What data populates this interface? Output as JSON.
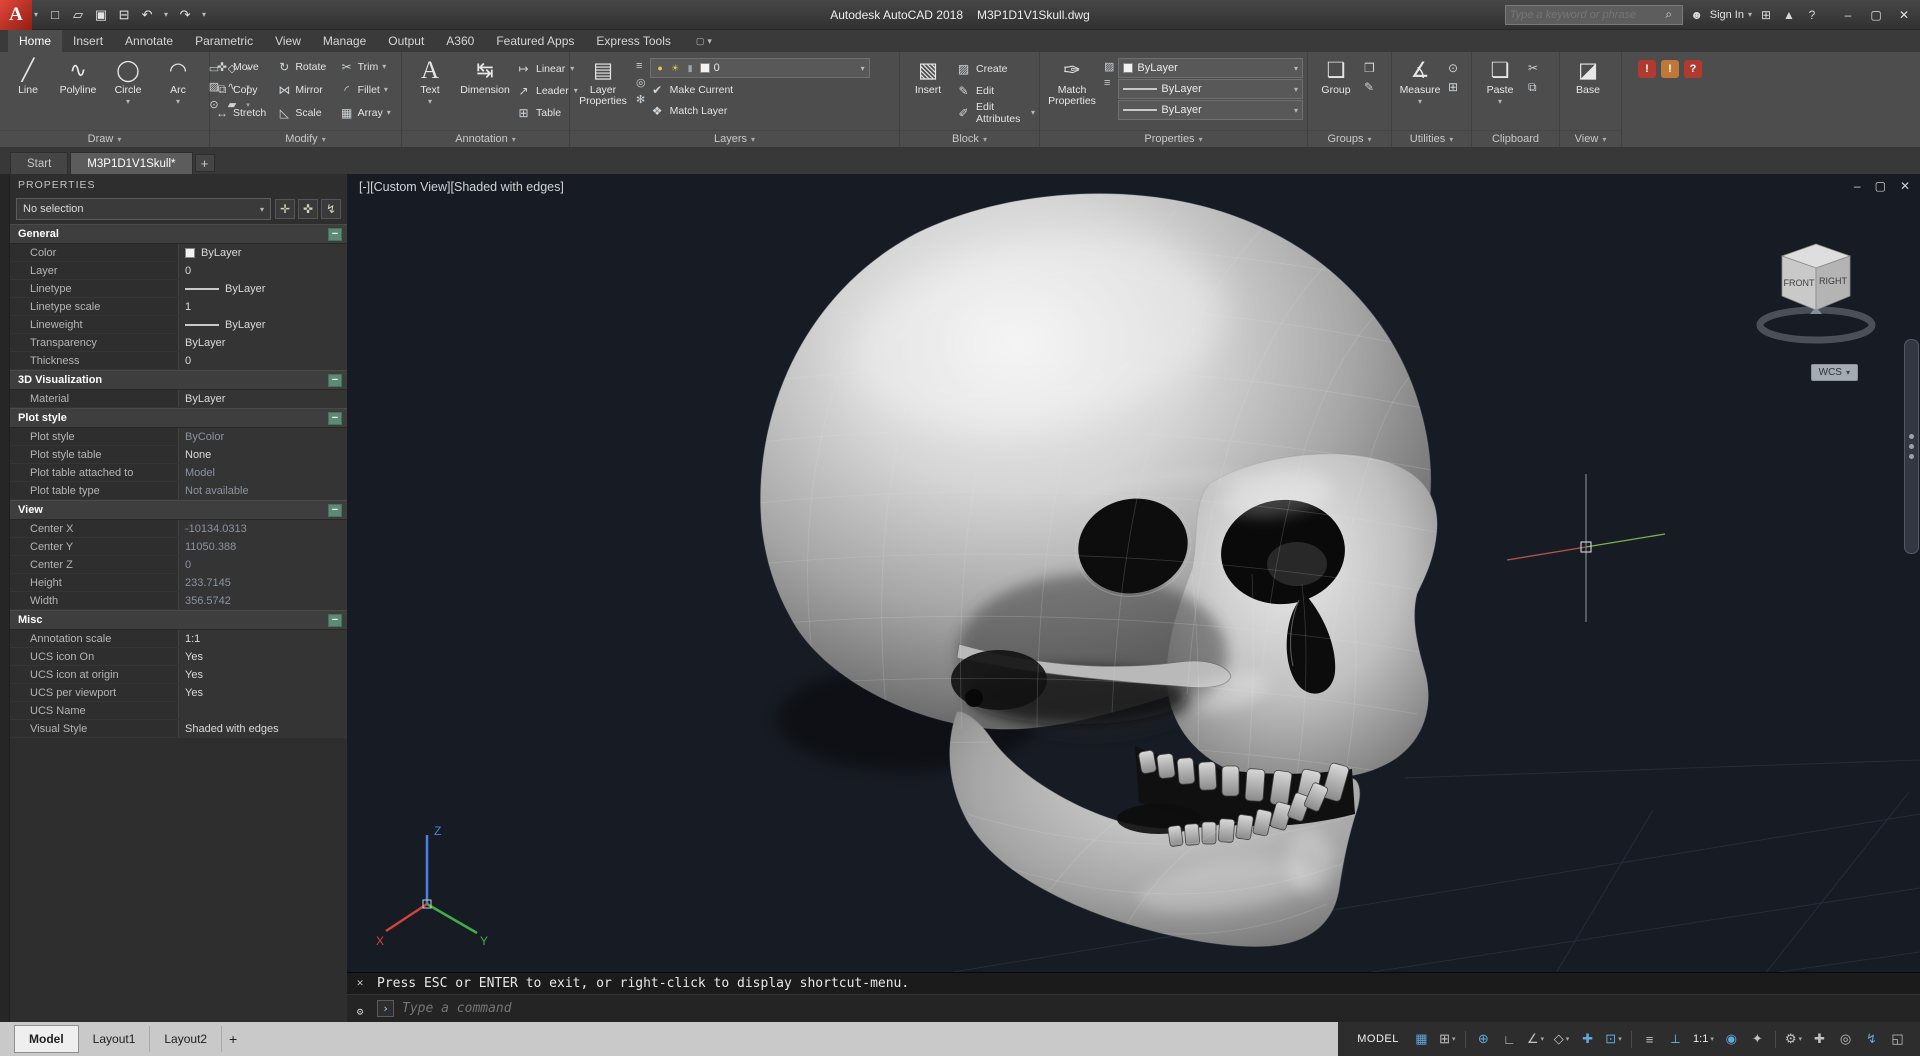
{
  "colors": {
    "logo_red": "#c8372b",
    "titlebar_bg": "#3c3c3c",
    "ribbon_bg": "#4d4d4d",
    "palette_bg": "#2e2e2e",
    "viewport_bg": "#171b23",
    "accent_blue": "#5fa8dc",
    "axis_x_red": "#d0453a",
    "axis_y_green": "#3fae4a",
    "axis_z_blue": "#4a7fe8",
    "collapse_green": "#5c8a72"
  },
  "icons": {
    "app-logo": "A",
    "new-file": "□",
    "open-file": "▱",
    "save": "▣",
    "plot": "⊟",
    "undo": "↶",
    "redo": "↷",
    "caret-down": "▾",
    "caret-right": "▸",
    "search": "⌕",
    "user": "☻",
    "app-store": "⊞",
    "alert": "▲",
    "help": "?",
    "minimize": "–",
    "maximize": "▢",
    "close": "✕",
    "line": "╱",
    "polyline": "∿",
    "circle": "◯",
    "arc": "◠",
    "rect": "▭",
    "ellipse": "◇",
    "hatch": "▨",
    "spline": "∿",
    "point": "⊙",
    "region": "▰",
    "move": "✜",
    "rotate": "↻",
    "trim": "✂",
    "copy": "⧉",
    "mirror": "⋈",
    "fillet": "◜",
    "stretch": "↔",
    "scale": "◺",
    "array": "▦",
    "text": "A",
    "dimension": "↹",
    "linear": "↦",
    "leader": "↗",
    "table": "⊞",
    "layer-properties": "▤",
    "layer-state": "≡",
    "layer-isolate": "◎",
    "layer-freeze": "✻",
    "bulb": "●",
    "sun": "☀",
    "lock": "▮",
    "make-current": "✔",
    "match-layer": "❖",
    "insert-block": "▧",
    "create-block": "▨",
    "edit-block": "✎",
    "edit-attributes": "✐",
    "match-properties": "✑",
    "group": "❑",
    "ungroup": "❒",
    "group-edit": "✎",
    "measure": "∡",
    "id-point": "⊙",
    "calc": "⊞",
    "paste": "❏",
    "cut-clip": "✂",
    "copy-clip": "⧉",
    "base-view": "◪",
    "grid": "▦",
    "snap": "⊞",
    "ortho": "∟",
    "polar": "∠",
    "isodraft": "◇",
    "osnap-tracking": "✚",
    "osnap": "⊡",
    "lineweight": "≡",
    "dynamic-ucs": "⟂",
    "dynamic-input": "⊕",
    "annotation-visibility": "◉",
    "autoscale": "✦",
    "workspace": "⚙",
    "annotation-monitor": "✚",
    "isolate": "◎",
    "graphics-performance": "↯",
    "clean-screen": "◱",
    "collapse": "−",
    "pickadd": "✛",
    "select-objects": "✜",
    "quick-select": "↯",
    "cmd-close": "✕",
    "cmd-tools": "⚙",
    "cmd-prompt": "›"
  },
  "titlebar": {
    "app_name": "Autodesk AutoCAD 2018",
    "doc_name": "M3P1D1V1Skull.dwg",
    "search_placeholder": "Type a keyword or phrase",
    "sign_in_label": "Sign In"
  },
  "ribbon_tabs": [
    {
      "label": "Home",
      "active": true
    },
    {
      "label": "Insert",
      "active": false
    },
    {
      "label": "Annotate",
      "active": false
    },
    {
      "label": "Parametric",
      "active": false
    },
    {
      "label": "View",
      "active": false
    },
    {
      "label": "Manage",
      "active": false
    },
    {
      "label": "Output",
      "active": false
    },
    {
      "label": "A360",
      "active": false
    },
    {
      "label": "Featured Apps",
      "active": false
    },
    {
      "label": "Express Tools",
      "active": false
    }
  ],
  "ribbon": {
    "draw": {
      "label": "Draw",
      "buttons": [
        {
          "name": "line",
          "label": "Line"
        },
        {
          "name": "polyline",
          "label": "Polyline"
        },
        {
          "name": "circle",
          "label": "Circle",
          "caret": true
        },
        {
          "name": "arc",
          "label": "Arc",
          "caret": true
        }
      ]
    },
    "modify": {
      "label": "Modify",
      "buttons": [
        {
          "name": "move",
          "label": "Move"
        },
        {
          "name": "rotate",
          "label": "Rotate"
        },
        {
          "name": "trim",
          "label": "Trim",
          "caret": true
        },
        {
          "name": "copy",
          "label": "Copy"
        },
        {
          "name": "mirror",
          "label": "Mirror"
        },
        {
          "name": "fillet",
          "label": "Fillet",
          "caret": true
        },
        {
          "name": "stretch",
          "label": "Stretch"
        },
        {
          "name": "scale",
          "label": "Scale"
        },
        {
          "name": "array",
          "label": "Array",
          "caret": true
        }
      ]
    },
    "annotation": {
      "label": "Annotation",
      "big": [
        {
          "name": "text",
          "label": "Text",
          "caret": true
        },
        {
          "name": "dimension",
          "label": "Dimension"
        }
      ],
      "small": [
        {
          "name": "linear",
          "label": "Linear",
          "caret": true
        },
        {
          "name": "leader",
          "label": "Leader",
          "caret": true
        },
        {
          "name": "table",
          "label": "Table"
        }
      ]
    },
    "layers": {
      "label": "Layers",
      "big_label": "Layer Properties",
      "dropdown_value": "0",
      "rows": [
        {
          "name": "make-current",
          "label": "Make Current"
        },
        {
          "name": "match-layer",
          "label": "Match Layer"
        }
      ]
    },
    "block": {
      "label": "Block",
      "big_label": "Insert",
      "rows": [
        {
          "name": "create-block",
          "label": "Create"
        },
        {
          "name": "edit-block",
          "label": "Edit"
        },
        {
          "name": "edit-attributes",
          "label": "Edit Attributes",
          "caret": true
        }
      ]
    },
    "properties_panel": {
      "label": "Properties",
      "big_label": "Match Properties",
      "dropdowns": [
        "ByLayer",
        "ByLayer",
        "ByLayer"
      ]
    },
    "groups": {
      "label": "Groups",
      "big_label": "Group"
    },
    "utilities": {
      "label": "Utilities",
      "big_label": "Measure"
    },
    "clipboard": {
      "label": "Clipboard",
      "big_label": "Paste"
    },
    "view_panel": {
      "label": "View",
      "big_label": "Base"
    }
  },
  "file_tabs": [
    {
      "label": "Start",
      "active": false
    },
    {
      "label": "M3P1D1V1Skull*",
      "active": true
    }
  ],
  "add_tab_label": "+",
  "properties_palette": {
    "title": "PROPERTIES",
    "selector_value": "No selection",
    "sections": [
      {
        "name": "General",
        "rows": [
          {
            "label": "Color",
            "value": "ByLayer",
            "swatch": "color"
          },
          {
            "label": "Layer",
            "value": "0"
          },
          {
            "label": "Linetype",
            "value": "ByLayer",
            "swatch": "line"
          },
          {
            "label": "Linetype scale",
            "value": "1"
          },
          {
            "label": "Lineweight",
            "value": "ByLayer",
            "swatch": "line"
          },
          {
            "label": "Transparency",
            "value": "ByLayer"
          },
          {
            "label": "Thickness",
            "value": "0"
          }
        ]
      },
      {
        "name": "3D Visualization",
        "rows": [
          {
            "label": "Material",
            "value": "ByLayer"
          }
        ]
      },
      {
        "name": "Plot style",
        "rows": [
          {
            "label": "Plot style",
            "value": "ByColor",
            "muted": true
          },
          {
            "label": "Plot style table",
            "value": "None"
          },
          {
            "label": "Plot table attached to",
            "value": "Model",
            "muted": true
          },
          {
            "label": "Plot table type",
            "value": "Not available",
            "muted": true
          }
        ]
      },
      {
        "name": "View",
        "rows": [
          {
            "label": "Center X",
            "value": "-10134.0313",
            "muted": true
          },
          {
            "label": "Center Y",
            "value": "11050.388",
            "muted": true
          },
          {
            "label": "Center Z",
            "value": "0",
            "muted": true
          },
          {
            "label": "Height",
            "value": "233.7145",
            "muted": true
          },
          {
            "label": "Width",
            "value": "356.5742",
            "muted": true
          }
        ]
      },
      {
        "name": "Misc",
        "rows": [
          {
            "label": "Annotation scale",
            "value": "1:1"
          },
          {
            "label": "UCS icon On",
            "value": "Yes"
          },
          {
            "label": "UCS icon at origin",
            "value": "Yes"
          },
          {
            "label": "UCS per viewport",
            "value": "Yes"
          },
          {
            "label": "UCS Name",
            "value": ""
          },
          {
            "label": "Visual Style",
            "value": "Shaded with edges"
          }
        ]
      }
    ]
  },
  "viewport": {
    "controls": {
      "minimized": "-",
      "view_name": "Custom View",
      "visual_style": "Shaded with edges"
    },
    "viewcube": {
      "front": "FRONT",
      "right": "RIGHT"
    },
    "wcs_label": "WCS",
    "axis_labels": {
      "x": "X",
      "y": "Y",
      "z": "Z"
    }
  },
  "command_line": {
    "message": "Press ESC or ENTER to exit, or right-click to display shortcut-menu.",
    "input_placeholder": "Type a command"
  },
  "layout_tabs": [
    {
      "label": "Model",
      "active": true
    },
    {
      "label": "Layout1",
      "active": false
    },
    {
      "label": "Layout2",
      "active": false
    }
  ],
  "layout_add_label": "+",
  "statusbar": {
    "model_label": "MODEL",
    "items": [
      {
        "name": "grid-display-toggle",
        "icon": "grid",
        "on": true
      },
      {
        "name": "snap-mode-toggle",
        "icon": "snap",
        "on": false,
        "caret": true
      },
      {
        "sep": true
      },
      {
        "name": "dynamic-input-toggle",
        "icon": "dynamic-input",
        "on": true
      },
      {
        "name": "ortho-mode-toggle",
        "icon": "ortho",
        "on": false
      },
      {
        "name": "polar-tracking-toggle",
        "icon": "polar",
        "on": false,
        "caret": true
      },
      {
        "name": "isodraft-toggle",
        "icon": "isodraft",
        "on": false,
        "caret": true
      },
      {
        "name": "osnap-tracking-toggle",
        "icon": "osnap-tracking",
        "on": true
      },
      {
        "name": "object-snap-toggle",
        "icon": "osnap",
        "on": true,
        "caret": true
      },
      {
        "sep": true
      },
      {
        "name": "lineweight-display-toggle",
        "icon": "lineweight",
        "on": false
      },
      {
        "name": "dynamic-ucs-toggle",
        "icon": "dynamic-ucs",
        "on": true
      },
      {
        "name": "annotation-scale-button",
        "label": "1:1",
        "caret": true
      },
      {
        "name": "annotation-visibility-toggle",
        "icon": "annotation-visibility",
        "on": true
      },
      {
        "name": "autoscale-toggle",
        "icon": "autoscale",
        "on": false
      },
      {
        "sep": true
      },
      {
        "name": "workspace-switching-button",
        "icon": "workspace",
        "on": false,
        "caret": true
      },
      {
        "name": "annotation-monitor-toggle",
        "icon": "annotation-monitor",
        "on": false
      },
      {
        "name": "isolate-objects-button",
        "icon": "isolate",
        "on": false
      },
      {
        "name": "graphics-performance-toggle",
        "icon": "graphics-performance",
        "on": true
      },
      {
        "name": "clean-screen-toggle",
        "icon": "clean-screen",
        "on": false
      }
    ]
  }
}
